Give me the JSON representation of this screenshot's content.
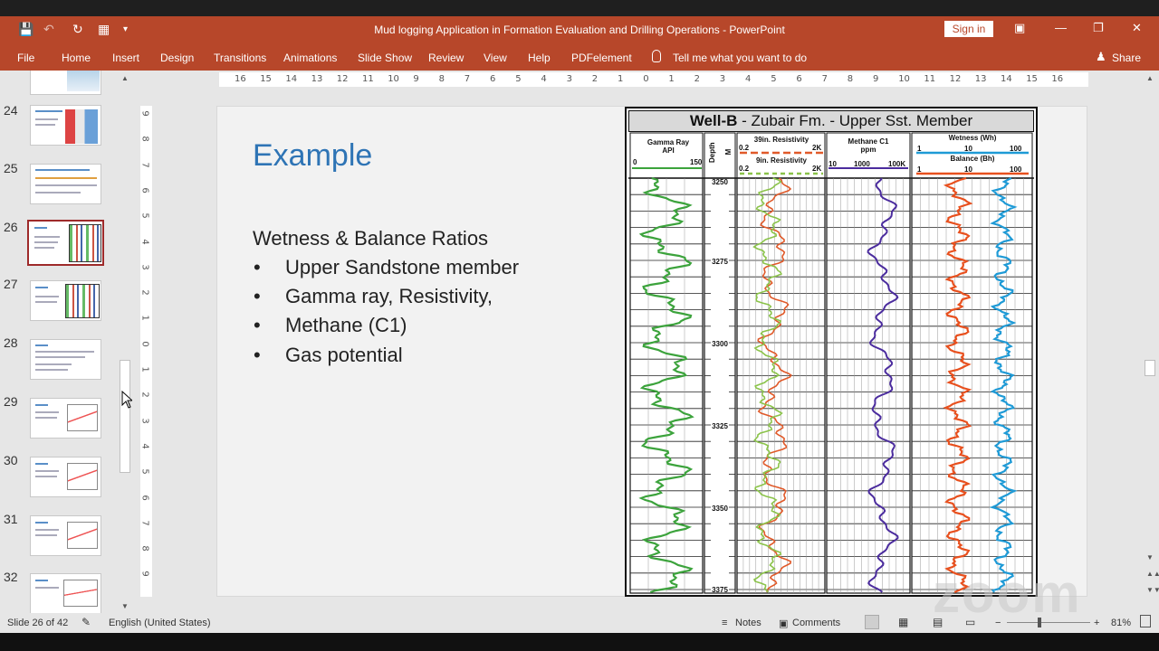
{
  "title_bar": {
    "document_title": "Mud logging Application in Formation Evaluation and Drilling Operations  -  PowerPoint",
    "sign_in_label": "Sign in"
  },
  "ribbon": {
    "tabs": [
      "File",
      "Home",
      "Insert",
      "Design",
      "Transitions",
      "Animations",
      "Slide Show",
      "Review",
      "View",
      "Help",
      "PDFelement"
    ],
    "tell_me": "Tell me what you want to do",
    "share": "Share"
  },
  "thumbnails": {
    "numbers": [
      "24",
      "25",
      "26",
      "27",
      "28",
      "29",
      "30",
      "31",
      "32"
    ],
    "selected": "26"
  },
  "rulers": {
    "horizontal": [
      "16",
      "15",
      "14",
      "13",
      "12",
      "11",
      "10",
      "9",
      "8",
      "7",
      "6",
      "5",
      "4",
      "3",
      "2",
      "1",
      "0",
      "1",
      "2",
      "3",
      "4",
      "5",
      "6",
      "7",
      "8",
      "9",
      "10",
      "11",
      "12",
      "13",
      "14",
      "15",
      "16"
    ],
    "vertical": [
      "9",
      "8",
      "7",
      "6",
      "5",
      "4",
      "3",
      "2",
      "1",
      "0",
      "1",
      "2",
      "3",
      "4",
      "5",
      "6",
      "7",
      "8",
      "9"
    ]
  },
  "slide": {
    "title": "Example",
    "heading": "Wetness & Balance Ratios",
    "bullets": [
      "Upper Sandstone member",
      "Gamma ray, Resistivity,",
      "Methane (C1)",
      "Gas potential"
    ],
    "bullet_glyph": "•"
  },
  "well_log": {
    "header_bold": "Well-B",
    "header_rest": " - Zubair Fm. - Upper Sst. Member",
    "track_gamma": {
      "label": "Gamma Ray",
      "unit": "API",
      "min": "0",
      "max": "150"
    },
    "track_depth": {
      "label": "Depth",
      "unit": "M"
    },
    "track_resistivity": {
      "deep_label": "39in. Resistivity",
      "deep_min": "0.2",
      "deep_max": "2K",
      "shallow_label": "9in. Resistivity",
      "shallow_min": "0.2",
      "shallow_max": "2K"
    },
    "track_methane": {
      "label": "Methane C1",
      "unit": "ppm",
      "ticks": [
        "10",
        "1000",
        "100K"
      ]
    },
    "track_ratios": {
      "wetness_label": "Wetness (Wh)",
      "wetness_ticks": [
        "1",
        "10",
        "100"
      ],
      "balance_label": "Balance (Bh)",
      "balance_ticks": [
        "1",
        "10",
        "100"
      ]
    },
    "depths": [
      "3250",
      "3275",
      "3300",
      "3325",
      "3350",
      "3375"
    ],
    "colors": {
      "gamma": "#3ca33c",
      "deep_res": "#e05a2a",
      "shallow_res": "#8bc34a",
      "methane": "#4b2c9e",
      "wetness": "#1e9ad6",
      "balance": "#e8501e"
    }
  },
  "status_bar": {
    "slide_info": "Slide 26 of 42",
    "language": "English (United States)",
    "notes": "Notes",
    "comments": "Comments",
    "zoom": "81%"
  },
  "watermark": "zoom"
}
